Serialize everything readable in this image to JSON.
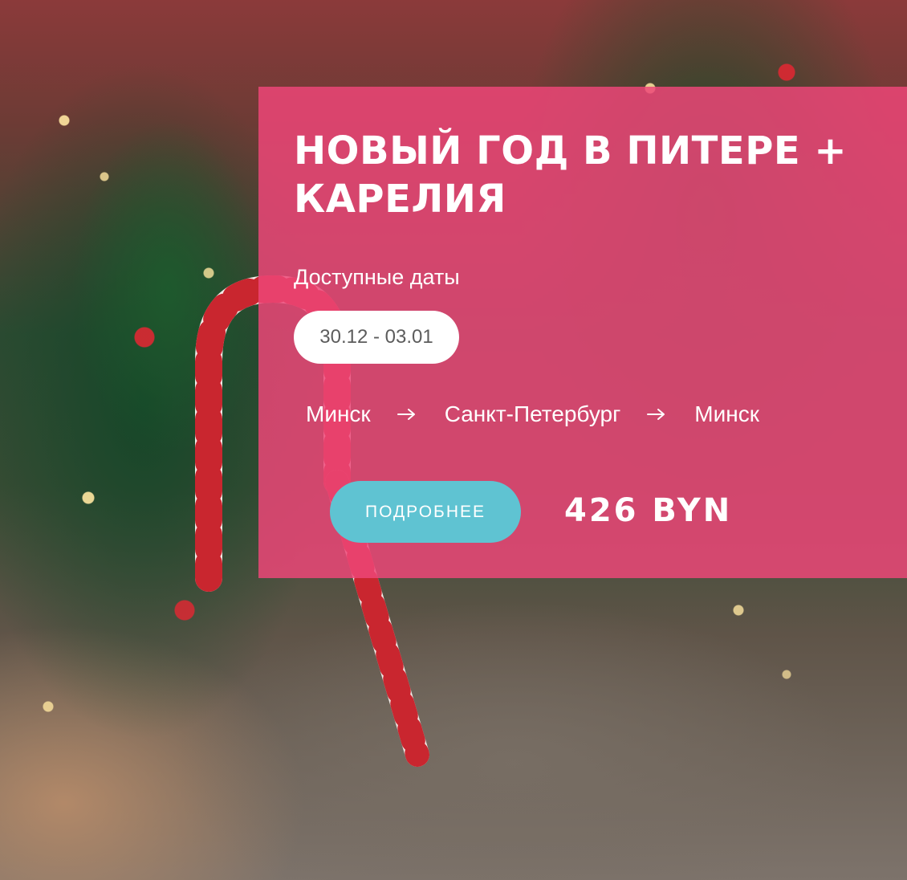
{
  "tour": {
    "title": "НОВЫЙ ГОД В ПИТЕРЕ + КАРЕЛИЯ",
    "dates_label": "Доступные даты",
    "date_option": "30.12 - 03.01",
    "route": [
      "Минск",
      "Санкт-Петербург",
      "Минск"
    ],
    "details_button": "ПОДРОБНЕЕ",
    "price": "426 BYN"
  },
  "icons": {
    "route_arrow": "arrow-right-icon"
  },
  "colors": {
    "card_background": "#ee4678",
    "button_background": "#5fc3d2",
    "pill_background": "#ffffff",
    "text_primary": "#ffffff",
    "pill_text": "#5c5c5c"
  }
}
